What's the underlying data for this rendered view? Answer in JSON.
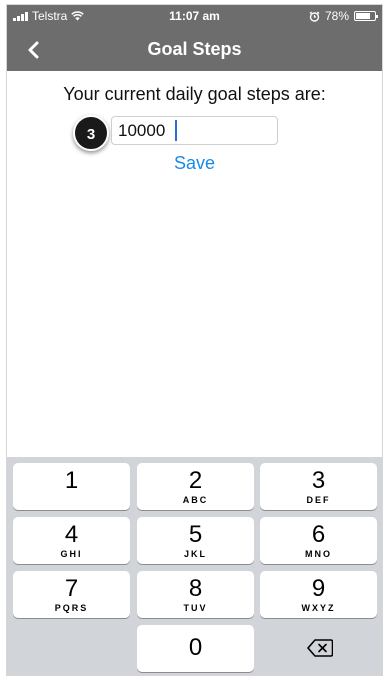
{
  "status_bar": {
    "carrier": "Telstra",
    "time": "11:07 am",
    "battery_percent": "78%",
    "battery_level": 0.78,
    "icons": [
      "signal-bars-icon",
      "wifi-icon",
      "alarm-icon",
      "battery-icon"
    ]
  },
  "nav": {
    "title": "Goal Steps",
    "back_icon": "chevron-left-icon"
  },
  "main": {
    "prompt": "Your current daily goal steps are:",
    "step_badge": "3",
    "goal_input_value": "10000",
    "save_label": "Save"
  },
  "keyboard": {
    "keys": [
      {
        "num": "1",
        "letters": ""
      },
      {
        "num": "2",
        "letters": "ABC"
      },
      {
        "num": "3",
        "letters": "DEF"
      },
      {
        "num": "4",
        "letters": "GHI"
      },
      {
        "num": "5",
        "letters": "JKL"
      },
      {
        "num": "6",
        "letters": "MNO"
      },
      {
        "num": "7",
        "letters": "PQRS"
      },
      {
        "num": "8",
        "letters": "TUV"
      },
      {
        "num": "9",
        "letters": "WXYZ"
      },
      {
        "num": "0",
        "letters": ""
      }
    ],
    "delete_icon": "backspace-icon"
  },
  "colors": {
    "bar_background": "#6d6d6d",
    "link_blue": "#1a8ae8",
    "keyboard_background": "#d1d4d9"
  }
}
